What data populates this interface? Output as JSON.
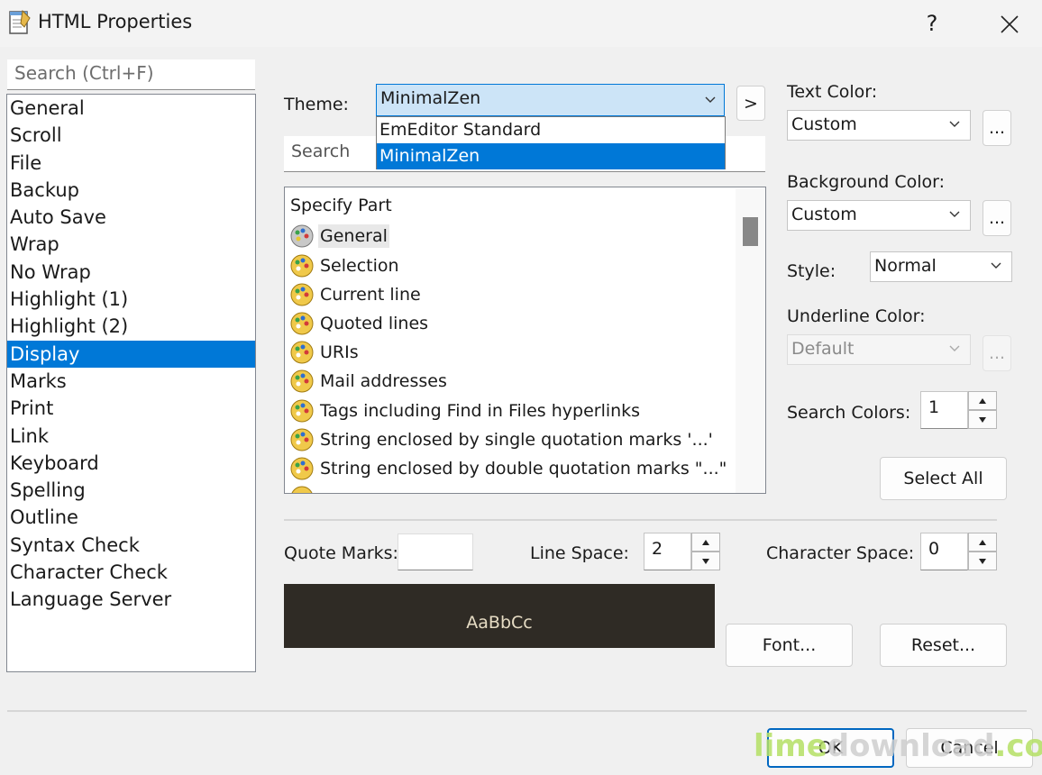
{
  "window": {
    "title": "HTML Properties",
    "help_label": "?"
  },
  "sidebar": {
    "search_placeholder": "Search (Ctrl+F)",
    "items": [
      "General",
      "Scroll",
      "File",
      "Backup",
      "Auto Save",
      "Wrap",
      "No Wrap",
      "Highlight (1)",
      "Highlight (2)",
      "Display",
      "Marks",
      "Print",
      "Link",
      "Keyboard",
      "Spelling",
      "Outline",
      "Syntax Check",
      "Character Check",
      "Language Server"
    ],
    "selected": "Display"
  },
  "theme": {
    "label": "Theme:",
    "value": "MinimalZen",
    "next_label": ">",
    "options": [
      "EmEditor Standard",
      "MinimalZen"
    ],
    "selected_option": "MinimalZen"
  },
  "parts": {
    "search_placeholder": "Search",
    "header": "Specify Part",
    "items": [
      "General",
      "Selection",
      "Current line",
      "Quoted lines",
      "URIs",
      "Mail addresses",
      "Tags including Find in Files hyperlinks",
      "String enclosed by single quotation marks '...'",
      "String enclosed by double quotation marks \"...\""
    ],
    "selected": "General"
  },
  "text_color": {
    "label": "Text Color:",
    "value": "Custom",
    "button": "..."
  },
  "background_color": {
    "label": "Background Color:",
    "value": "Custom",
    "button": "..."
  },
  "style": {
    "label": "Style:",
    "value": "Normal"
  },
  "underline_color": {
    "label": "Underline Color:",
    "value": "Default",
    "button": "..."
  },
  "search_colors": {
    "label": "Search Colors:",
    "value": "1"
  },
  "select_all_label": "Select All",
  "quote_marks": {
    "label": "Quote Marks:",
    "value": ""
  },
  "line_space": {
    "label": "Line Space:",
    "value": "2"
  },
  "character_space": {
    "label": "Character Space:",
    "value": "0"
  },
  "preview": {
    "text": "AaBbCc",
    "background": "#2f2b25",
    "foreground": "#e6dcc4"
  },
  "buttons": {
    "font": "Font...",
    "reset": "Reset...",
    "ok": "OK",
    "cancel": "Cancel"
  },
  "watermark": {
    "part1": "lime",
    "part2": "download",
    "part3": ".com"
  },
  "colors": {
    "accent": "#0078d7",
    "selection_highlight": "#cce4f7"
  }
}
